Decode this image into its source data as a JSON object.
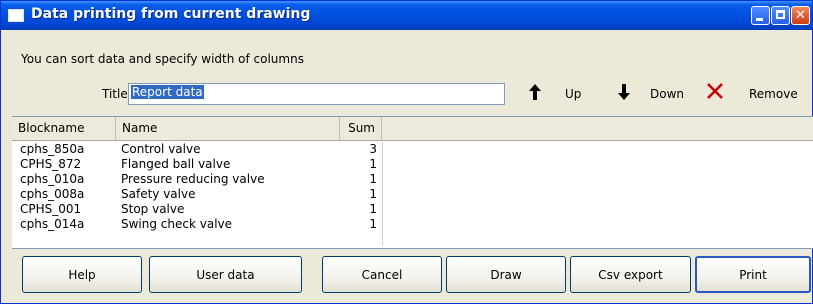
{
  "window": {
    "title": "Data printing from current drawing"
  },
  "hint": "You can sort data and specify width of columns",
  "report_title": {
    "label": "Title",
    "value": "Report data"
  },
  "toolbar": {
    "up_label": "Up",
    "up_icon": "arrow-up-icon",
    "down_label": "Down",
    "down_icon": "arrow-down-icon",
    "remove_label": "Remove",
    "remove_icon": "red-x-icon",
    "remove_color": "#cc0000"
  },
  "table": {
    "columns": [
      "Blockname",
      "Name",
      "Sum"
    ],
    "rows": [
      {
        "blockname": "cphs_850a",
        "name": "Control valve",
        "sum": "3"
      },
      {
        "blockname": "CPHS_872",
        "name": "Flanged ball valve",
        "sum": "1"
      },
      {
        "blockname": "cphs_010a",
        "name": "Pressure reducing valve",
        "sum": "1"
      },
      {
        "blockname": "cphs_008a",
        "name": "Safety valve",
        "sum": "1"
      },
      {
        "blockname": "CPHS_001",
        "name": "Stop valve",
        "sum": "1"
      },
      {
        "blockname": "cphs_014a",
        "name": "Swing check valve",
        "sum": "1"
      }
    ]
  },
  "buttons": {
    "help": "Help",
    "user_data": "User data",
    "cancel": "Cancel",
    "draw": "Draw",
    "csv_export": "Csv export",
    "print": "Print"
  },
  "colors": {
    "titlebar": "#0052e3",
    "dialog_bg": "#ece9d8",
    "selection": "#316ac5"
  }
}
